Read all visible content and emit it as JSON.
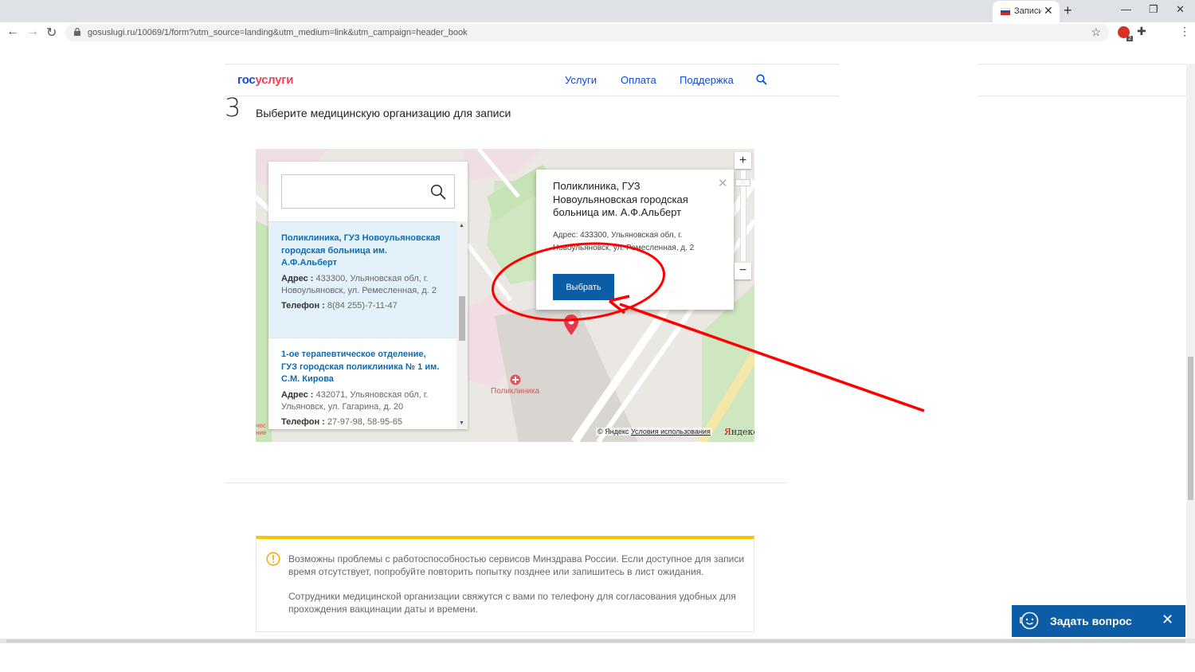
{
  "browser": {
    "tab_title": "Записи",
    "tab_close": "✕",
    "new_tab": "+",
    "url": "gosuslugi.ru/10069/1/form?utm_source=landing&utm_medium=link&utm_campaign=header_book",
    "abp_badge": "2"
  },
  "header": {
    "logo_part1": "гос",
    "logo_part2": "услуги",
    "nav": [
      "Услуги",
      "Оплата",
      "Поддержка"
    ]
  },
  "step": {
    "number": "3",
    "title": "Выберите медицинскую организацию для записи"
  },
  "search": {
    "value": ""
  },
  "results": [
    {
      "name": "Поликлиника, ГУЗ Новоульяновская городская больница им. А.Ф.Альберт",
      "address_label": "Адрес :",
      "address": "433300, Ульяновская обл, г. Новоульяновск, ул. Ремесленная, д. 2",
      "phone_label": "Телефон :",
      "phone": "8(84 255)-7-11-47"
    },
    {
      "name": "1-ое терапевтическое отделение, ГУЗ городская поликлиника № 1 им. С.М. Кирова",
      "address_label": "Адрес :",
      "address": "432071, Ульяновская обл, г. Ульяновск, ул. Гагарина, д. 20",
      "phone_label": "Телефон :",
      "phone": "27-97-98, 58-95-65"
    }
  ],
  "balloon": {
    "title": "Поликлиника, ГУЗ Новоульяновская городская больница им. А.Ф.Альберт",
    "address": "Адрес: 433300, Ульяновская обл, г. Новоульяновск, ул. Ремесленная, д. 2",
    "button": "Выбрать",
    "close": "✕"
  },
  "map": {
    "poi_label": "Поликлиника",
    "copyright_prefix": "© Яндекс",
    "terms_link": "Условия использования",
    "logo_first": "Я",
    "logo_rest": "ндекс",
    "edge_text": "чес\nние",
    "zoom_in": "+",
    "zoom_out": "−"
  },
  "notice": {
    "p1": "Возможны проблемы с работоспособностью сервисов Минздрава России. Если доступное для записи время отсутствует, попробуйте повторить попытку позднее или запишитесь в лист ожидания.",
    "p2": "Сотрудники медицинской организации свяжутся с вами по телефону для согласования удобных для прохождения вакцинации даты и времени."
  },
  "ask": {
    "label": "Задать вопрос",
    "close": "✕"
  },
  "colors": {
    "brand_blue": "#0d4cd3",
    "brand_red": "#ee3f58",
    "button_blue": "#0d5da6",
    "notice_yellow": "#f5c600",
    "annotation_red": "#ff0000"
  }
}
